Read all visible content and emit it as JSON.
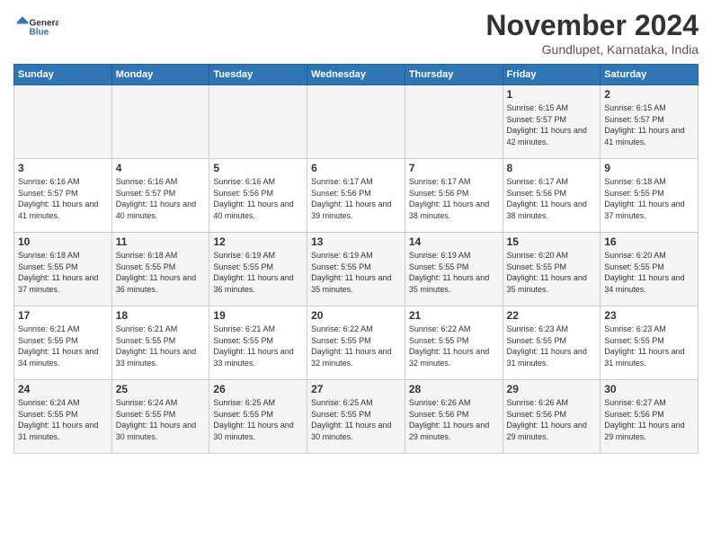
{
  "logo": {
    "line1": "General",
    "line2": "Blue"
  },
  "title": "November 2024",
  "subtitle": "Gundlupet, Karnataka, India",
  "weekdays": [
    "Sunday",
    "Monday",
    "Tuesday",
    "Wednesday",
    "Thursday",
    "Friday",
    "Saturday"
  ],
  "weeks": [
    [
      {
        "day": "",
        "info": ""
      },
      {
        "day": "",
        "info": ""
      },
      {
        "day": "",
        "info": ""
      },
      {
        "day": "",
        "info": ""
      },
      {
        "day": "",
        "info": ""
      },
      {
        "day": "1",
        "info": "Sunrise: 6:15 AM\nSunset: 5:57 PM\nDaylight: 11 hours and 42 minutes."
      },
      {
        "day": "2",
        "info": "Sunrise: 6:15 AM\nSunset: 5:57 PM\nDaylight: 11 hours and 41 minutes."
      }
    ],
    [
      {
        "day": "3",
        "info": "Sunrise: 6:16 AM\nSunset: 5:57 PM\nDaylight: 11 hours and 41 minutes."
      },
      {
        "day": "4",
        "info": "Sunrise: 6:16 AM\nSunset: 5:57 PM\nDaylight: 11 hours and 40 minutes."
      },
      {
        "day": "5",
        "info": "Sunrise: 6:16 AM\nSunset: 5:56 PM\nDaylight: 11 hours and 40 minutes."
      },
      {
        "day": "6",
        "info": "Sunrise: 6:17 AM\nSunset: 5:56 PM\nDaylight: 11 hours and 39 minutes."
      },
      {
        "day": "7",
        "info": "Sunrise: 6:17 AM\nSunset: 5:56 PM\nDaylight: 11 hours and 38 minutes."
      },
      {
        "day": "8",
        "info": "Sunrise: 6:17 AM\nSunset: 5:56 PM\nDaylight: 11 hours and 38 minutes."
      },
      {
        "day": "9",
        "info": "Sunrise: 6:18 AM\nSunset: 5:55 PM\nDaylight: 11 hours and 37 minutes."
      }
    ],
    [
      {
        "day": "10",
        "info": "Sunrise: 6:18 AM\nSunset: 5:55 PM\nDaylight: 11 hours and 37 minutes."
      },
      {
        "day": "11",
        "info": "Sunrise: 6:18 AM\nSunset: 5:55 PM\nDaylight: 11 hours and 36 minutes."
      },
      {
        "day": "12",
        "info": "Sunrise: 6:19 AM\nSunset: 5:55 PM\nDaylight: 11 hours and 36 minutes."
      },
      {
        "day": "13",
        "info": "Sunrise: 6:19 AM\nSunset: 5:55 PM\nDaylight: 11 hours and 35 minutes."
      },
      {
        "day": "14",
        "info": "Sunrise: 6:19 AM\nSunset: 5:55 PM\nDaylight: 11 hours and 35 minutes."
      },
      {
        "day": "15",
        "info": "Sunrise: 6:20 AM\nSunset: 5:55 PM\nDaylight: 11 hours and 35 minutes."
      },
      {
        "day": "16",
        "info": "Sunrise: 6:20 AM\nSunset: 5:55 PM\nDaylight: 11 hours and 34 minutes."
      }
    ],
    [
      {
        "day": "17",
        "info": "Sunrise: 6:21 AM\nSunset: 5:55 PM\nDaylight: 11 hours and 34 minutes."
      },
      {
        "day": "18",
        "info": "Sunrise: 6:21 AM\nSunset: 5:55 PM\nDaylight: 11 hours and 33 minutes."
      },
      {
        "day": "19",
        "info": "Sunrise: 6:21 AM\nSunset: 5:55 PM\nDaylight: 11 hours and 33 minutes."
      },
      {
        "day": "20",
        "info": "Sunrise: 6:22 AM\nSunset: 5:55 PM\nDaylight: 11 hours and 32 minutes."
      },
      {
        "day": "21",
        "info": "Sunrise: 6:22 AM\nSunset: 5:55 PM\nDaylight: 11 hours and 32 minutes."
      },
      {
        "day": "22",
        "info": "Sunrise: 6:23 AM\nSunset: 5:55 PM\nDaylight: 11 hours and 31 minutes."
      },
      {
        "day": "23",
        "info": "Sunrise: 6:23 AM\nSunset: 5:55 PM\nDaylight: 11 hours and 31 minutes."
      }
    ],
    [
      {
        "day": "24",
        "info": "Sunrise: 6:24 AM\nSunset: 5:55 PM\nDaylight: 11 hours and 31 minutes."
      },
      {
        "day": "25",
        "info": "Sunrise: 6:24 AM\nSunset: 5:55 PM\nDaylight: 11 hours and 30 minutes."
      },
      {
        "day": "26",
        "info": "Sunrise: 6:25 AM\nSunset: 5:55 PM\nDaylight: 11 hours and 30 minutes."
      },
      {
        "day": "27",
        "info": "Sunrise: 6:25 AM\nSunset: 5:55 PM\nDaylight: 11 hours and 30 minutes."
      },
      {
        "day": "28",
        "info": "Sunrise: 6:26 AM\nSunset: 5:56 PM\nDaylight: 11 hours and 29 minutes."
      },
      {
        "day": "29",
        "info": "Sunrise: 6:26 AM\nSunset: 5:56 PM\nDaylight: 11 hours and 29 minutes."
      },
      {
        "day": "30",
        "info": "Sunrise: 6:27 AM\nSunset: 5:56 PM\nDaylight: 11 hours and 29 minutes."
      }
    ]
  ]
}
